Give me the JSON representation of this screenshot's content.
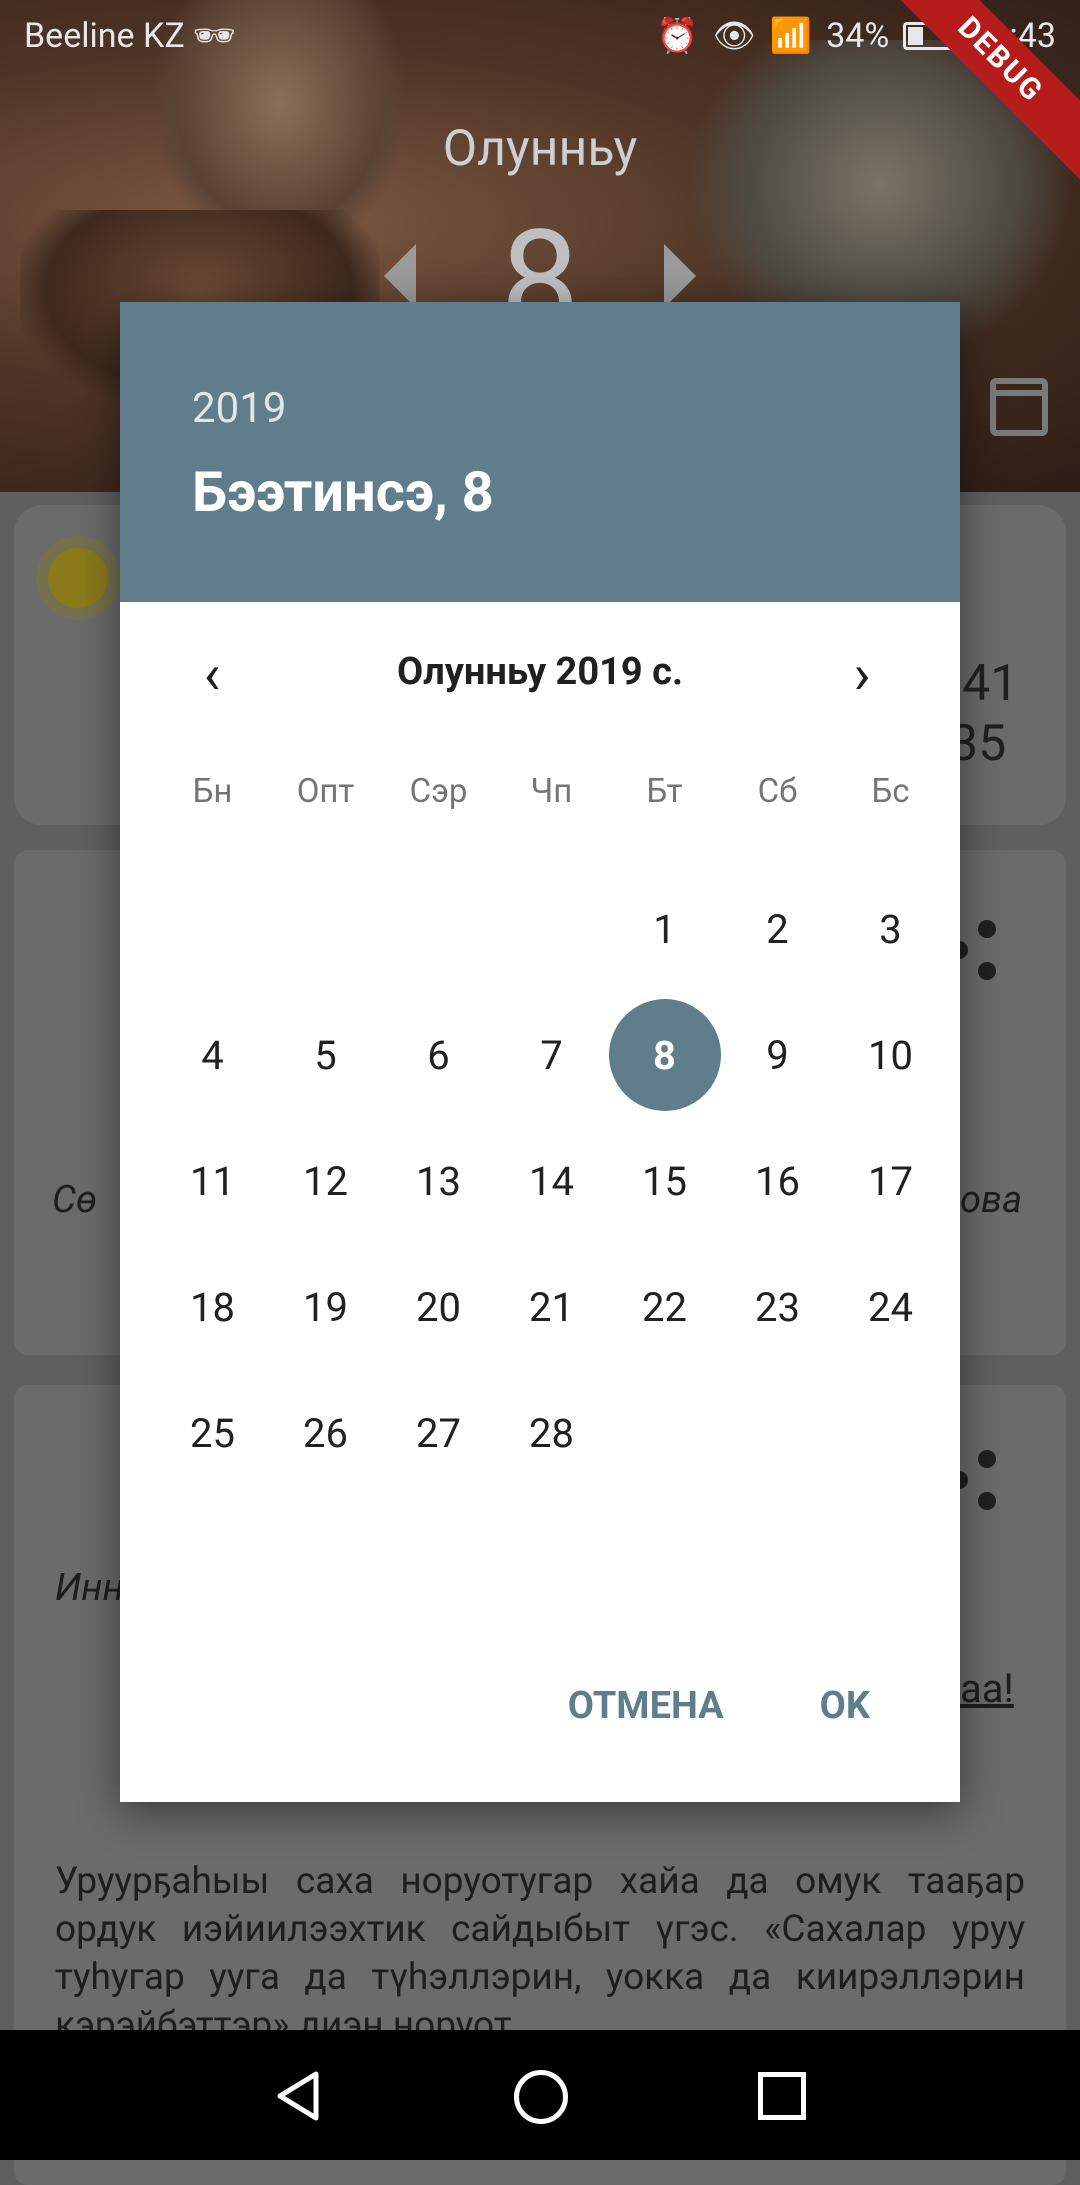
{
  "status_bar": {
    "carrier": "Beeline KZ",
    "battery": "34%",
    "battery_level": 0.34,
    "time": "11:43"
  },
  "debug_banner": "DEBUG",
  "background": {
    "month_title": "Олунньу",
    "day_number": "8",
    "time_line1": ":41",
    "time_line2": "35",
    "italic_left_1": "Сө",
    "italic_right_1": "ова",
    "italic_left_2": "Инн",
    "link_fragment": "аа!",
    "paragraph": "Уруурҕаһыы саха норуотугар хайа да омук тааҕар ордук иэйиилээхтик сайдыбыт үгэс. «Сахалар уруу туһугар ууга да түһэллэрин, уокка да киирэллэрин кэрэйбэттэр» диэн норуот"
  },
  "dialog": {
    "header_year": "2019",
    "header_date": "Бээтинсэ, 8",
    "month_label": "Олунньу 2019 с.",
    "weekdays": [
      "Бн",
      "Опт",
      "Сэр",
      "Чп",
      "Бт",
      "Сб",
      "Бс"
    ],
    "weeks": [
      [
        "",
        "",
        "",
        "",
        "1",
        "2",
        "3"
      ],
      [
        "4",
        "5",
        "6",
        "7",
        "8",
        "9",
        "10"
      ],
      [
        "11",
        "12",
        "13",
        "14",
        "15",
        "16",
        "17"
      ],
      [
        "18",
        "19",
        "20",
        "21",
        "22",
        "23",
        "24"
      ],
      [
        "25",
        "26",
        "27",
        "28",
        "",
        "",
        ""
      ]
    ],
    "selected_day": "8",
    "cancel_label": "ОТМЕНА",
    "ok_label": "OK"
  },
  "colors": {
    "accent": "#607d8b",
    "scrim": "#5f5f5f"
  },
  "icons": {
    "prev_month": "chevron-left-icon",
    "next_month": "chevron-right-icon",
    "calendar": "calendar-icon",
    "share": "share-icon"
  }
}
